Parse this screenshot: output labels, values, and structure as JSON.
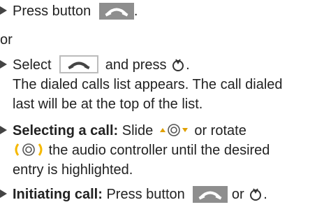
{
  "step1": {
    "text": "Press button",
    "punct": "."
  },
  "or": "or",
  "step2": {
    "text_before": "Select",
    "text_mid": "and press",
    "punct": "."
  },
  "step2_result": {
    "line1": "The dialed calls list appears. The call dialed",
    "line2": "last will be at the top of the list."
  },
  "step3": {
    "bold": "Selecting a call:",
    "text1": "Slide",
    "text2": "or rotate",
    "text3": "the audio controller until the desired",
    "line3": "entry is highlighted."
  },
  "step4": {
    "bold": "Initiating call:",
    "text1": "Press button",
    "text2": "or",
    "punct": "."
  },
  "icons": [
    "phone-handset-icon",
    "controller-press-icon",
    "slide-up-down-icon",
    "rotate-icon"
  ],
  "colors": {
    "button_dark": "#8e8e8e",
    "button_border": "#bcbcbc",
    "rotate_accent": "#f5b800",
    "slide_arrow": "#e0a000"
  }
}
